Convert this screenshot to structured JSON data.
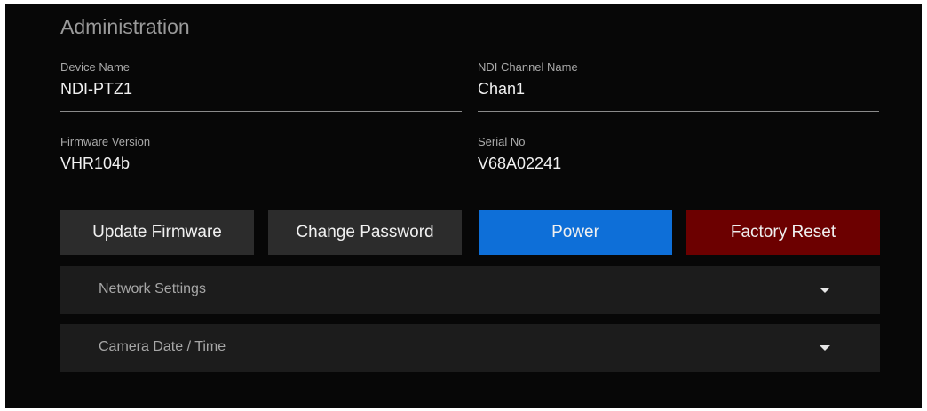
{
  "section_title": "Administration",
  "fields": {
    "device_name": {
      "label": "Device Name",
      "value": "NDI-PTZ1"
    },
    "ndi_channel_name": {
      "label": "NDI Channel Name",
      "value": "Chan1"
    },
    "firmware_version": {
      "label": "Firmware Version",
      "value": "VHR104b"
    },
    "serial_no": {
      "label": "Serial No",
      "value": "V68A02241"
    }
  },
  "buttons": {
    "update_firmware": "Update Firmware",
    "change_password": "Change Password",
    "power": "Power",
    "factory_reset": "Factory Reset"
  },
  "accordions": {
    "network_settings": "Network Settings",
    "camera_date_time": "Camera Date / Time"
  },
  "icons": {
    "expand": "chevron-down-icon"
  },
  "colors": {
    "panel_background": "#070707",
    "button_dark": "#2c2c2c",
    "button_power": "#0e6fd8",
    "button_factory_reset": "#6c0000",
    "accordion_background": "#1c1c1c"
  }
}
